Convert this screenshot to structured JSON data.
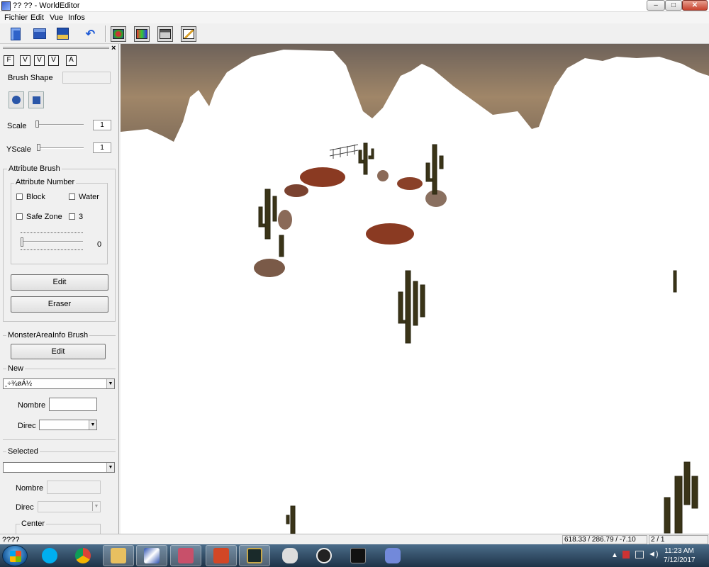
{
  "window": {
    "title": "?? ?? - WorldEditor",
    "controls": {
      "minimize": "–",
      "maximize": "□",
      "close": "✕"
    }
  },
  "menu": [
    "Fichier",
    "Edit",
    "Vue",
    "Infos"
  ],
  "toolbar": {
    "buttons": [
      "new-document-icon",
      "open-folder-icon",
      "save-icon",
      "undo-icon",
      "view-objects-icon",
      "view-colors-icon",
      "view-window-icon",
      "edit-pencil-icon"
    ]
  },
  "panel": {
    "close": "×",
    "mode_buttons": [
      "F",
      "V",
      "V",
      "V",
      "A"
    ],
    "brush_shape_label": "Brush Shape",
    "scale_label": "Scale",
    "scale_value": "1",
    "yscale_label": "YScale",
    "yscale_value": "1",
    "attribute_brush": {
      "title": "Attribute Brush",
      "attribute_number": "Attribute Number",
      "block": "Block",
      "water": "Water",
      "safe_zone": "Safe Zone",
      "three": "3",
      "slider_value": "0",
      "edit": "Edit",
      "eraser": "Eraser"
    },
    "monster_area": {
      "title": "MonsterAreaInfo Brush",
      "edit": "Edit",
      "new_title": "New",
      "new_combo": "¸÷¾øÁ½",
      "nombre": "Nombre",
      "direc": "Direc",
      "selected_title": "Selected",
      "nombre2": "Nombre",
      "direc2": "Direc",
      "center": "Center"
    }
  },
  "status": {
    "left": "????",
    "coords": "618.33 / 286.79 / -7.10",
    "page": "2 / 1"
  },
  "taskbar": {
    "apps": [
      "windows-explorer-icon",
      "skype-icon",
      "chrome-icon",
      "folder-icon",
      "worldeditor-icon",
      "game-icon",
      "powerpoint-icon",
      "league-icon",
      "wolf-icon",
      "obs-icon",
      "cmd-icon",
      "discord-icon"
    ],
    "clock_time": "11:23 AM",
    "clock_date": "7/12/2017"
  }
}
